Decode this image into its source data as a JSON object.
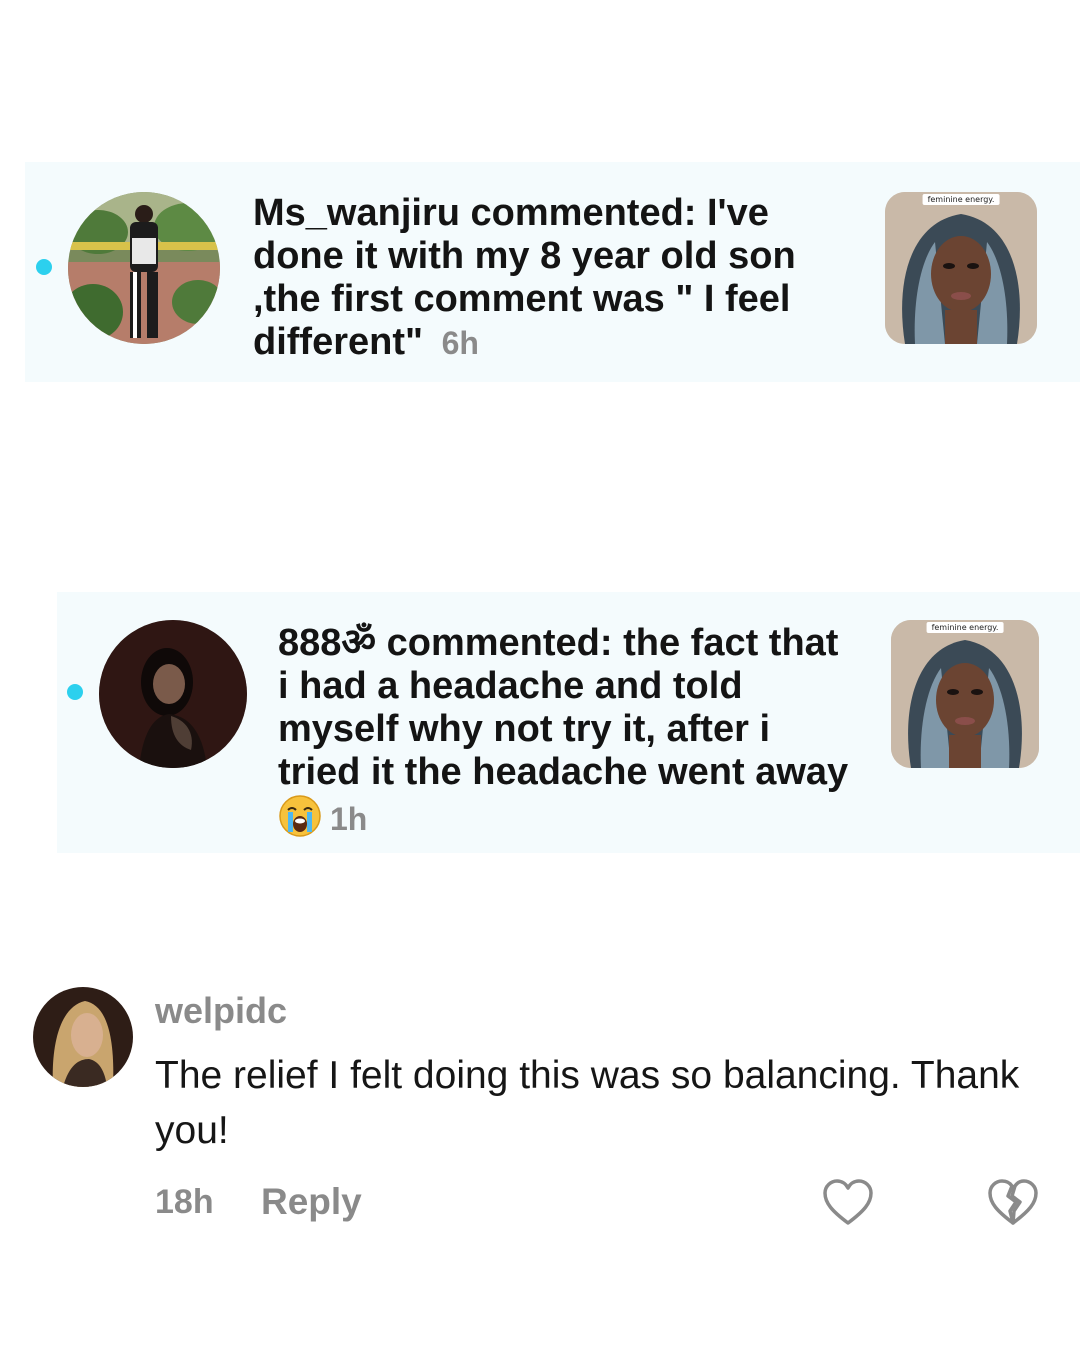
{
  "notifications": [
    {
      "username": "Ms_wanjiru",
      "action": "commented:",
      "text": "I've done it with my 8 year old son ,the first comment was \" I feel different\"",
      "time": "6h",
      "thumb_caption": "feminine energy."
    },
    {
      "username": "888ॐ",
      "action": "commented:",
      "text": "the fact that i had a headache and told myself why not try it, after i tried it the headache went away",
      "time": "1h",
      "thumb_caption": "feminine energy."
    }
  ],
  "comment": {
    "username": "welpidc",
    "text": "The relief I felt doing this was so balancing. Thank you!",
    "time": "18h",
    "reply_label": "Reply"
  },
  "icons": {
    "like": "heart-outline-icon",
    "dislike": "broken-heart-outline-icon",
    "emoji": "loudly-crying-face-emoji"
  },
  "colors": {
    "card_background": "#f4fbfd",
    "unread_dot": "#2cd0ee",
    "muted_text": "#8a8a8a"
  }
}
